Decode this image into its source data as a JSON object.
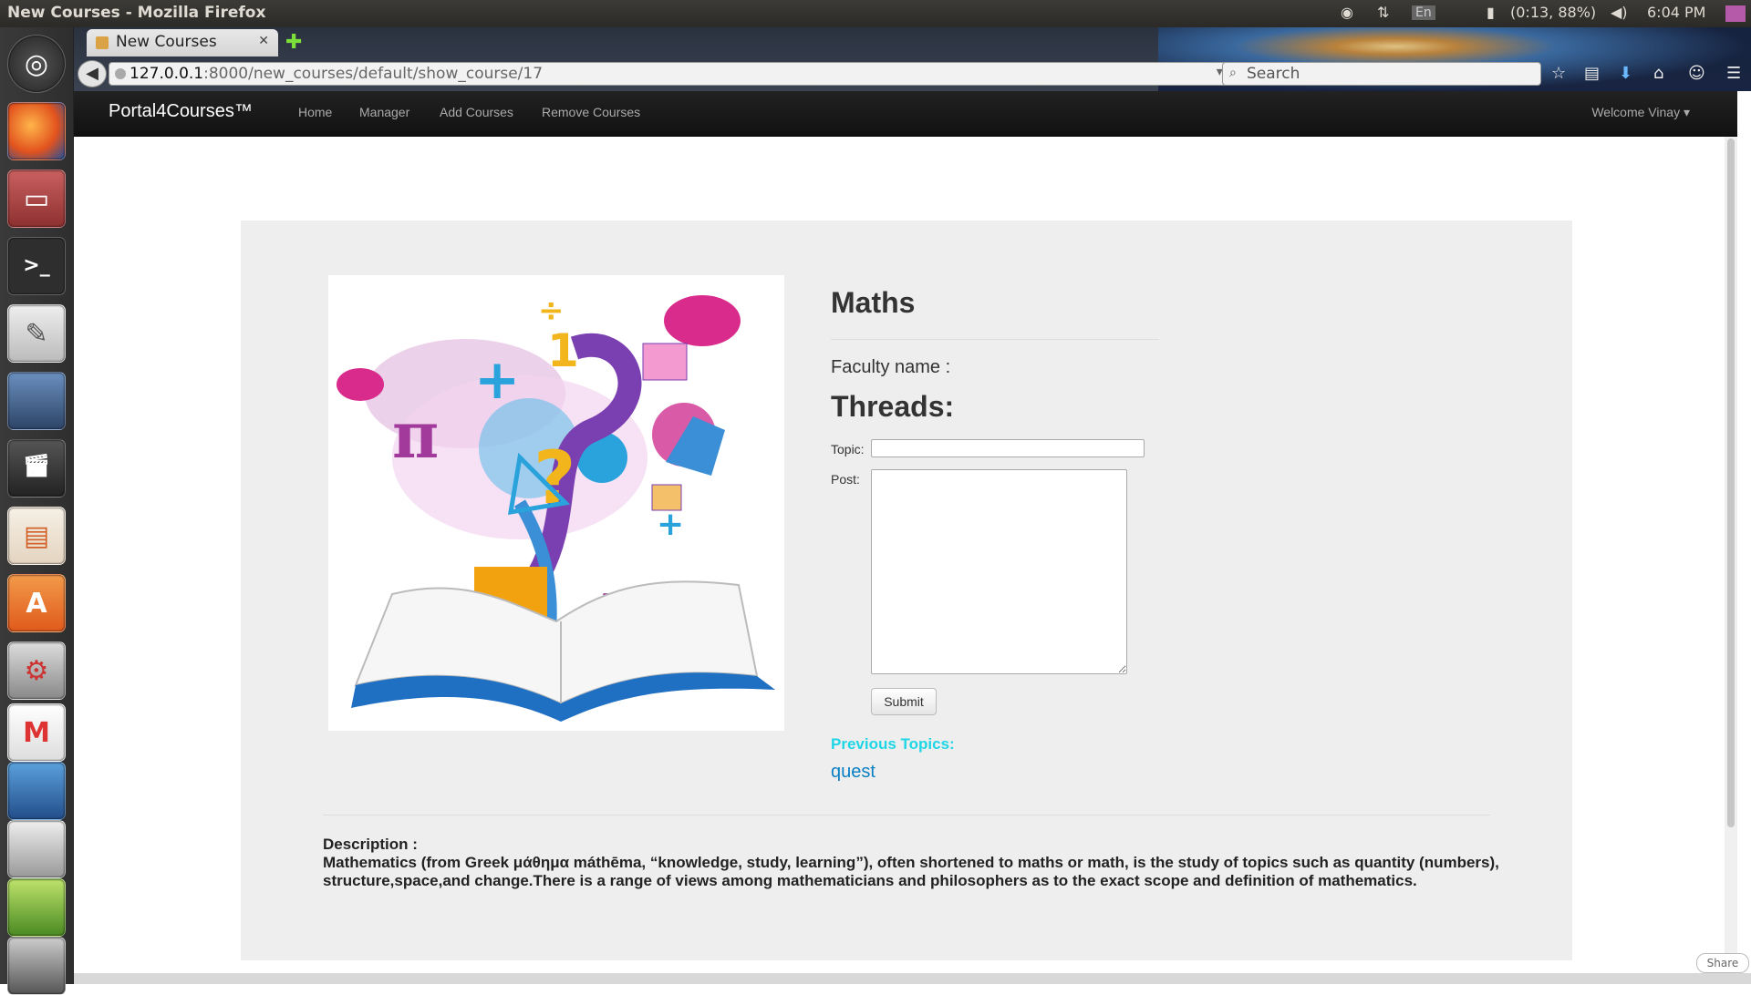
{
  "system": {
    "window_title": "New Courses - Mozilla Firefox",
    "keyboard": "En",
    "battery": "(0:13, 88%)",
    "clock": "6:04 PM"
  },
  "browser": {
    "tab_title": "New Courses",
    "url_host": "127.0.0.1",
    "url_path": ":8000/new_courses/default/show_course/17",
    "search_placeholder": "Search"
  },
  "navbar": {
    "brand": "Portal4Courses™",
    "links": [
      "Home",
      "Manager",
      "Add Courses",
      "Remove Courses"
    ],
    "welcome": "Welcome Vinay"
  },
  "course": {
    "title": "Maths",
    "faculty_label": "Faculty name :",
    "threads_heading": "Threads:",
    "topic_label": "Topic:",
    "topic_value": "",
    "post_label": "Post:",
    "post_value": "",
    "submit_label": "Submit",
    "previous_topics_label": "Previous Topics:",
    "previous_topics": [
      "quest"
    ],
    "description_label": "Description :",
    "description_text": "Mathematics (from Greek μάθημα máthēma, “knowledge, study, learning”), often shortened to maths or math, is the study of topics such as quantity (numbers), structure,space,and change.There is a range of views among mathematicians and philosophers as to the exact scope and definition of mathematics."
  },
  "share_label": "Share"
}
